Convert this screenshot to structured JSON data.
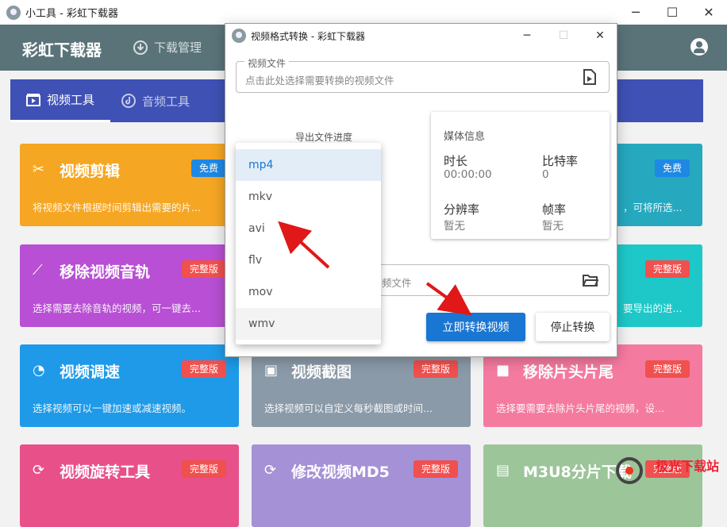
{
  "window": {
    "title": "小工具 - 彩虹下载器",
    "minimize": "─",
    "maximize": "☐",
    "close": "✕"
  },
  "appbar": {
    "app_name": "彩虹下载器",
    "nav_download": "下载管理"
  },
  "tabs": [
    {
      "label": "视频工具"
    },
    {
      "label": "音频工具"
    }
  ],
  "cards": [
    {
      "title": "视频剪辑",
      "badge": "免费",
      "desc": "将视频文件根据时间剪辑出需要的片...",
      "color": "#f5a623"
    },
    {
      "title": "",
      "badge": "免费",
      "desc": "，可将所选...",
      "color": "#26a8bf"
    },
    {
      "title": "移除视频音轨",
      "badge": "完整版",
      "desc": "选择需要去除音轨的视频，可一键去...",
      "color": "#b84fd4"
    },
    {
      "title": "",
      "badge": "完整版",
      "desc": "要导出的进...",
      "color": "#1ec8c8"
    },
    {
      "title": "视频调速",
      "badge": "完整版",
      "desc": "选择视频可以一键加速或减速视频。",
      "color": "#1e9ae8"
    },
    {
      "title": "视频截图",
      "badge": "完整版",
      "desc": "选择视频可以自定义每秒截图或时间...",
      "color": "#8a9aa8"
    },
    {
      "title": "移除片头片尾",
      "badge": "完整版",
      "desc": "选择要需要去除片头片尾的视频，设...",
      "color": "#f57aa0"
    },
    {
      "title": "视频旋转工具",
      "badge": "完整版",
      "desc": "",
      "color": "#e8508a"
    },
    {
      "title": "修改视频MD5",
      "badge": "完整版",
      "desc": "",
      "color": "#a591d6"
    },
    {
      "title": "M3U8分片下载",
      "badge": "完整版",
      "desc": "",
      "color": "#9cc59a"
    }
  ],
  "dialog": {
    "title": "视频格式转换 - 彩虹下载器",
    "video_file_label": "视频文件",
    "video_file_placeholder": "点击此处选择需要转换的视频文件",
    "progress_label": "导出文件进度",
    "media_info": {
      "title": "媒体信息",
      "duration_label": "时长",
      "duration_value": "00:00:00",
      "bitrate_label": "比特率",
      "bitrate_value": "0",
      "resolution_label": "分辨率",
      "resolution_value": "暂无",
      "framerate_label": "帧率",
      "framerate_value": "暂无"
    },
    "save_placeholder": "频文件",
    "convert_button": "立即转换视频",
    "stop_button": "停止转换"
  },
  "format_options": [
    "mp4",
    "mkv",
    "avi",
    "flv",
    "mov",
    "wmv"
  ],
  "selected_format": "mp4",
  "watermark": {
    "text": "极光下载站"
  },
  "icons": {
    "app": "app-logo-icon",
    "download": "download-icon",
    "user": "account-circle-icon"
  }
}
